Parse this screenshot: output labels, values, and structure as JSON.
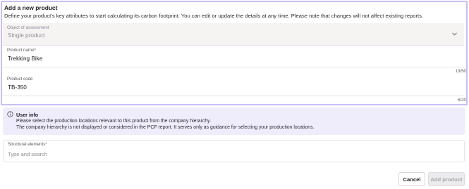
{
  "panel": {
    "title": "Add a new product",
    "description": "Define your product’s key attributes to start calculating its carbon footprint. You can edit or update the details at any time. Please note that changes will not affect existing reports."
  },
  "fields": {
    "object": {
      "label": "Object of assessment",
      "value": "Single product"
    },
    "product_name": {
      "label": "Product name*",
      "value": "Trekking Bike",
      "counter": "13/50"
    },
    "product_code": {
      "label": "Product code",
      "value": "TB-350",
      "counter": "6/20"
    }
  },
  "info": {
    "title": "User info",
    "line1": "Please select the production locations relevant to this product from the company hierarchy.",
    "line2": "The company hierarchy is not displayed or considered in the PCF report. It serves only as guidance for selecting your production locations."
  },
  "structural": {
    "label": "Structural elements*",
    "placeholder": "Type and search"
  },
  "buttons": {
    "cancel": "Cancel",
    "add": "Add product"
  },
  "colors": {
    "accent_border": "#c9bff2",
    "info_background": "#efecfb"
  }
}
